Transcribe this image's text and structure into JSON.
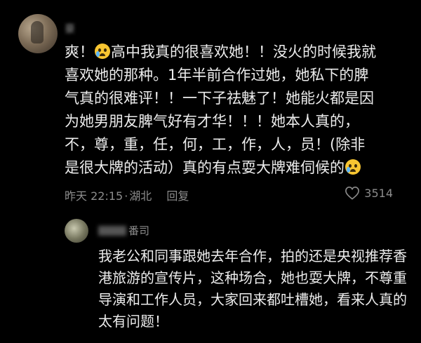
{
  "main_comment": {
    "username": "豪",
    "text_lines": [
      "高中我真的很喜欢她！！没火的时候我就",
      "喜欢她的那种。1年半前合作过她，她私下的脾",
      "气真的很难评！！一下子祛魅了！她能火都是因",
      "为她男朋友脾气好有才华！！！她本人真的，",
      "不，尊，重，任，何，工，作，人，员！(除非",
      "是很大牌的活动）真的有点耍大牌难伺候的"
    ],
    "prefix": "爽！",
    "timestamp": "昨天 22:15",
    "location": "湖北",
    "reply_label": "回复",
    "like_count": "3514"
  },
  "reply_comment": {
    "username_visible": "番司",
    "text": "我老公和同事跟她去年合作，拍的还是央视推荐香港旅游的宣传片，这种场合，她也耍大牌，不尊重导演和工作人员，大家回来都吐槽她，看来人真的太有问题！"
  }
}
